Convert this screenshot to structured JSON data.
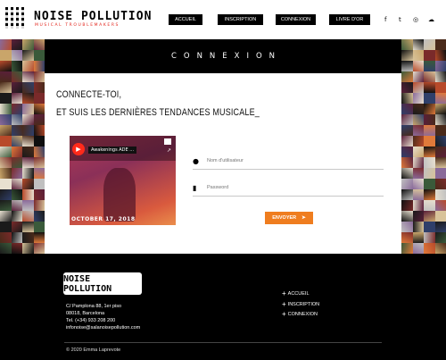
{
  "brand": {
    "name": "NOISE POLLUTION",
    "tagline": "MUSICAL TROUBLEMAKERS"
  },
  "nav": {
    "items": [
      {
        "label": "ACCUEIL"
      },
      {
        "label": "INSCRIPTION"
      },
      {
        "label": "CONNEXION"
      },
      {
        "label": "LIVRE D'OR"
      }
    ]
  },
  "social": [
    {
      "icon": "facebook-icon",
      "glyph": "f"
    },
    {
      "icon": "twitter-icon",
      "glyph": "t"
    },
    {
      "icon": "instagram-icon",
      "glyph": "◎"
    },
    {
      "icon": "soundcloud-icon",
      "glyph": "☁"
    }
  ],
  "main": {
    "heading": "CONNEXION",
    "intro_line1": "CONNECTE-TOI,",
    "intro_line2": "ET SUIS LES DERNIÈRES TENDANCES MUSICALE_",
    "video": {
      "title": "Awakenings ADE ...",
      "date": "OCTOBER 17, 2018"
    },
    "form": {
      "user_placeholder": "Nom d'utilisateur",
      "password_placeholder": "Password",
      "submit_label": "ENVOYER"
    }
  },
  "footer": {
    "logo_text": "NOISE POLLUTION",
    "address": [
      "C/ Pamplona 88, 1er piso",
      "08018, Barcelona",
      "Tel. (+34) 933 208 200",
      "infonoise@salanoisepollution.com"
    ],
    "links": [
      {
        "label": "ACCUEIL"
      },
      {
        "label": "INSCRIPTION"
      },
      {
        "label": "CONNEXION"
      }
    ],
    "copyright": "© 2020 Emma Laprevote"
  },
  "colors": {
    "accent_orange": "#ef7d1f",
    "brand_red": "#e2231a",
    "dark": "#000000"
  }
}
